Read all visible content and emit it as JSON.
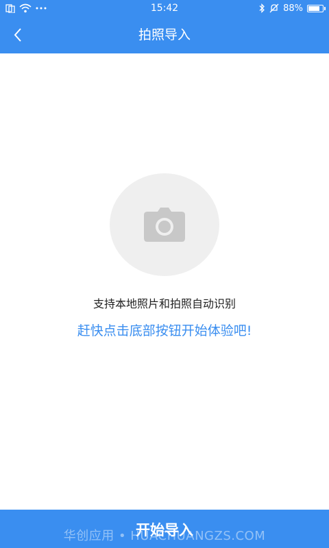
{
  "status_bar": {
    "time": "15:42",
    "battery": "88%",
    "battery_level": 0.88
  },
  "nav": {
    "title": "拍照导入"
  },
  "main": {
    "hint_primary": "支持本地照片和拍照自动识别",
    "hint_secondary": "赶快点击底部按钮开始体验吧!"
  },
  "bottom_bar": {
    "start_label": "开始导入",
    "watermark": "华创应用 • HUACHUANGZS.COM"
  },
  "colors": {
    "accent": "#3a8ef0",
    "circle_bg": "#efefef",
    "camera_icon": "#c8c8c8"
  }
}
